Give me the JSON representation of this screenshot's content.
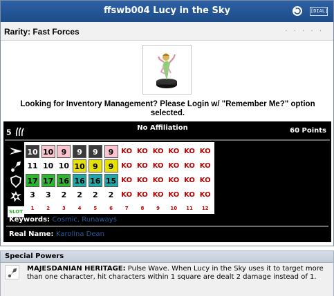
{
  "title": "ffswb004 Lucy in the Sky",
  "dial_button": "[DIAL]",
  "rarity": "Rarity: Fast Forces",
  "rarity_dots": ". . . . .",
  "login_message": "Looking for Inventory Management? Please Login w/ \"Remember Me?\" option selected.",
  "dial": {
    "points_badge": "5",
    "affiliation": "No Affiliation",
    "points": "60 Points",
    "rows": [
      {
        "icon": "speed-icon",
        "values": [
          "10",
          "10",
          "9",
          "9",
          "9",
          "9",
          "KO",
          "KO",
          "KO",
          "KO",
          "KO",
          "KO"
        ]
      },
      {
        "icon": "attack-icon",
        "values": [
          "11",
          "10",
          "10",
          "10",
          "9",
          "9",
          "KO",
          "KO",
          "KO",
          "KO",
          "KO",
          "KO"
        ]
      },
      {
        "icon": "defense-icon",
        "values": [
          "17",
          "17",
          "16",
          "16",
          "16",
          "15",
          "KO",
          "KO",
          "KO",
          "KO",
          "KO",
          "KO"
        ]
      },
      {
        "icon": "damage-icon",
        "values": [
          "3",
          "3",
          "2",
          "2",
          "2",
          "2",
          "KO",
          "KO",
          "KO",
          "KO",
          "KO",
          "KO"
        ]
      }
    ],
    "slot_label": "SLOT",
    "slots": [
      "1",
      "2",
      "3",
      "4",
      "5",
      "6",
      "7",
      "8",
      "9",
      "10",
      "11",
      "12"
    ],
    "keywords_label": "Keywords:",
    "keywords": "Cosmic, Runaways",
    "real_name_label": "Real Name:",
    "real_name": "Karolina Dean"
  },
  "special_powers": {
    "header": "Special Powers",
    "power_name": "MAJESDANIAN HERITAGE:",
    "power_text": "Pulse Wave. When Lucy in the Sky uses it to target more than one character, hit characters within 1 square are dealt 2 damage instead of 1."
  },
  "colors": {
    "title_bar": "#1f4e8c",
    "ko_text": "#b40000",
    "special_black": "#3a3a3a",
    "special_pink": "#f7c4cf",
    "special_yellow": "#e7e000",
    "special_green": "#2fb52f",
    "special_teal": "#22a7a7",
    "keyword_link": "#2a5aa0"
  }
}
